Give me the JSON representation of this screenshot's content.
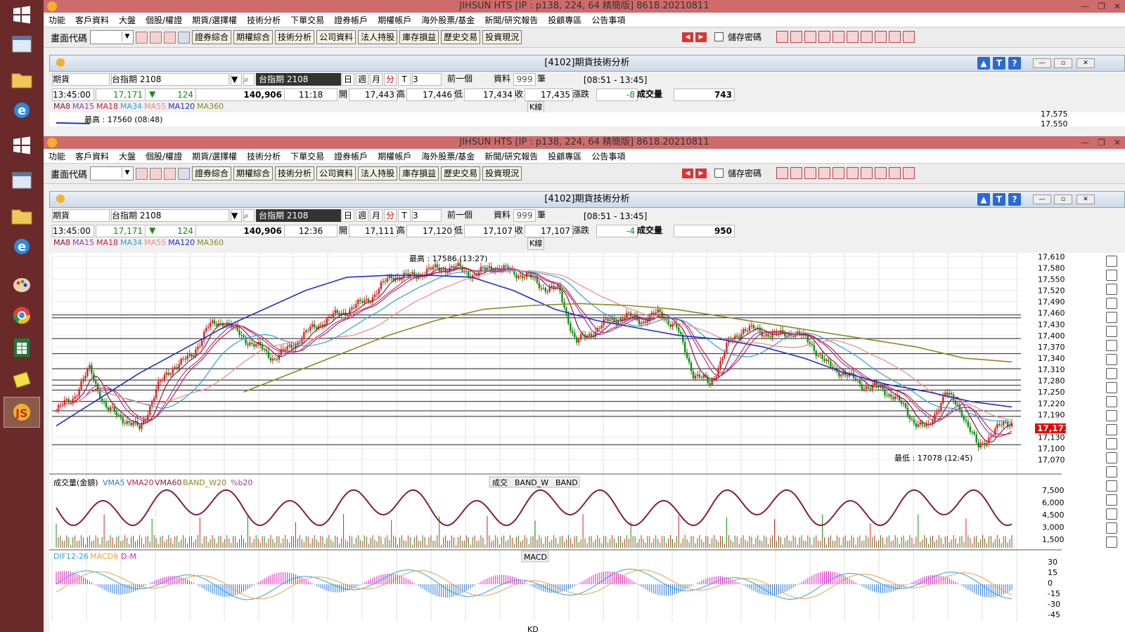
{
  "taskbar": {
    "icons": [
      "windows-start-icon",
      "explorer-window-icon",
      "file-folder-icon",
      "internet-explorer-icon",
      "paint-icon",
      "chrome-icon",
      "spreadsheet-icon",
      "note-icon",
      "jihsun-app-icon"
    ]
  },
  "app": {
    "title": "JIHSUN HTS      [IP : p138, 224, 64 精簡版] 8618.20210811",
    "menu": [
      "功能",
      "客戶資料",
      "大盤",
      "個股/權證",
      "期貨/選擇權",
      "技術分析",
      "下單交易",
      "證券帳戶",
      "期權帳戶",
      "海外股票/基金",
      "新聞/研究報告",
      "投顧專區",
      "公告事項"
    ],
    "toolbar": {
      "code_label": "畫面代碼",
      "buttons": [
        "證券綜合",
        "期權綜合",
        "技術分析",
        "公司資料",
        "法人持股",
        "庫存損益",
        "歷史交易",
        "投資現況"
      ],
      "remember_label": "儲存密碼"
    }
  },
  "child": {
    "title": "[4102]期貨技術分析",
    "right_buttons": [
      "▲",
      "T",
      "?"
    ]
  },
  "top_instance": {
    "query": {
      "market": "期貨",
      "product": "台指期 2108",
      "display": "台指期 2108",
      "period_buttons": [
        "日",
        "週",
        "月",
        "分",
        "T"
      ],
      "interval": "3",
      "prev_label": "前一個",
      "data_label": "資料",
      "count": "999",
      "count_unit": "筆",
      "session": "[08:51 - 13:45]"
    },
    "quote": {
      "time": "13:45:00",
      "price": "17,171",
      "change": "124",
      "volume_total": "140,906",
      "bar_time": "11:18",
      "open_label": "開",
      "open": "17,443",
      "high_label": "高",
      "high": "17,446",
      "low_label": "低",
      "low": "17,434",
      "close_label": "收",
      "close": "17,435",
      "chg_label": "漲跌",
      "chg": "-8",
      "vol_label": "成交量",
      "vol": "743"
    },
    "ma_legend": [
      "MA8",
      "MA15",
      "MA18",
      "MA34",
      "MA55",
      "MA120",
      "MA360"
    ],
    "kline_label": "K線",
    "hi_marker": "最高 : 17560 (08:48)",
    "axis_partial": [
      "17,575",
      "17,550"
    ]
  },
  "bottom_instance": {
    "query": {
      "market": "期貨",
      "product": "台指期 2108",
      "display": "台指期 2108",
      "period_buttons": [
        "日",
        "週",
        "月",
        "分",
        "T"
      ],
      "interval": "3",
      "prev_label": "前一個",
      "data_label": "資料",
      "count": "999",
      "count_unit": "筆",
      "session": "[08:51 - 13:45]"
    },
    "quote": {
      "time": "13:45:00",
      "price": "17,171",
      "change": "124",
      "volume_total": "140,906",
      "bar_time": "12:36",
      "open_label": "開",
      "open": "17,111",
      "high_label": "高",
      "high": "17,120",
      "low_label": "低",
      "low": "17,107",
      "close_label": "收",
      "close": "17,107",
      "chg_label": "漲跌",
      "chg": "-4",
      "vol_label": "成交量",
      "vol": "950"
    },
    "ma_legend": [
      "MA8",
      "MA15",
      "MA18",
      "MA34",
      "MA55",
      "MA120",
      "MA360"
    ],
    "kline_label": "K線",
    "hi_marker": "最高 : 17586 (13:27)",
    "lo_marker": "最低 : 17078 (12:45)",
    "current_price_tag": "17,171",
    "vol_legend": [
      "成交量(金額)",
      "VMA5",
      "VMA20",
      "VMA60",
      "BAND_W20",
      "%b20"
    ],
    "vol_tabs": [
      "成交",
      "BAND_W",
      "BAND"
    ],
    "macd_legend": [
      "DIF12-26",
      "MACD9",
      "D-M"
    ],
    "macd_label": "MACD",
    "kd_label": "KD"
  },
  "colors": {
    "titlebar": "#cf6b6b",
    "ma8": "#8b1a3a",
    "ma15": "#9a3fa0",
    "ma18": "#d0213c",
    "ma34": "#2fa3d6",
    "ma55": "#f08a8a",
    "ma120": "#1b2fd6",
    "ma360": "#8a8a1e",
    "up": "#e02020",
    "down": "#109010"
  },
  "chart_data": [
    {
      "type": "candlestick",
      "title": "[4102]期貨技術分析 台指期 2108 3分K",
      "ylim": [
        17060,
        17620
      ],
      "yticks": [
        "17,610",
        "17,580",
        "17,550",
        "17,520",
        "17,490",
        "17,460",
        "17,430",
        "17,400",
        "17,370",
        "17,340",
        "17,310",
        "17,280",
        "17,250",
        "17,220",
        "17,190",
        "17,130",
        "17,100",
        "17,070"
      ],
      "close_path": [
        17200,
        17235,
        17310,
        17205,
        17180,
        17150,
        17260,
        17320,
        17340,
        17420,
        17440,
        17400,
        17370,
        17340,
        17370,
        17410,
        17440,
        17460,
        17480,
        17510,
        17560,
        17555,
        17570,
        17580,
        17578,
        17560,
        17585,
        17570,
        17560,
        17530,
        17520,
        17380,
        17410,
        17440,
        17450,
        17440,
        17460,
        17420,
        17300,
        17270,
        17370,
        17420,
        17410,
        17400,
        17410,
        17380,
        17320,
        17300,
        17270,
        17260,
        17240,
        17180,
        17150,
        17250,
        17200,
        17100,
        17150,
        17171
      ],
      "series": [
        {
          "name": "MA120",
          "values": [
            17160,
            17230,
            17300,
            17360,
            17420,
            17470,
            17520,
            17555,
            17560,
            17560,
            17555,
            17520,
            17470,
            17440,
            17420,
            17400,
            17390,
            17370,
            17340,
            17300,
            17270,
            17250,
            17225,
            17210
          ]
        },
        {
          "name": "MA360",
          "values": [
            17250,
            17300,
            17350,
            17400,
            17440,
            17470,
            17480,
            17485,
            17480,
            17470,
            17450,
            17430,
            17410,
            17390,
            17370,
            17340,
            17330
          ]
        }
      ]
    },
    {
      "type": "bar",
      "title": "成交量(金額)",
      "yticks": [
        "7,500",
        "6,000",
        "4,500",
        "3,000",
        "1,500"
      ]
    },
    {
      "type": "line",
      "title": "MACD",
      "series": [
        {
          "name": "DIF12-26"
        },
        {
          "name": "MACD9"
        },
        {
          "name": "D-M"
        }
      ],
      "yticks": [
        "30",
        "15",
        "0",
        "-15",
        "-30",
        "-45"
      ]
    }
  ]
}
